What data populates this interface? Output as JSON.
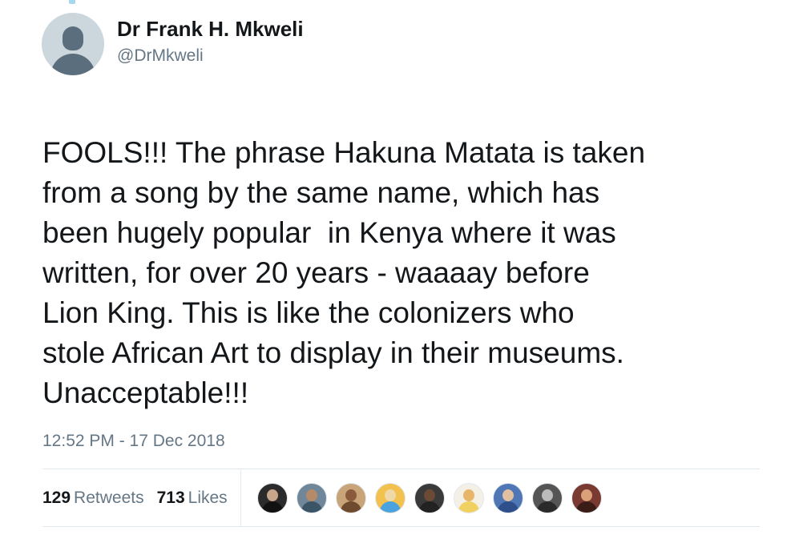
{
  "author": {
    "display_name": "Dr Frank H. Mkweli",
    "handle": "@DrMkweli",
    "avatar_icon": "default-profile-icon"
  },
  "tweet": {
    "text": "FOOLS!!! The phrase Hakuna Matata is taken\nfrom a song by the same name, which has\nbeen hugely popular  in Kenya where it was\nwritten, for over 20 years - waaaay before\nLion King. This is like the colonizers who\nstole African Art to display in their museums.\nUnacceptable!!!",
    "timestamp": "12:52 PM - 17 Dec 2018"
  },
  "stats": {
    "retweets_count": "129",
    "retweets_label": "Retweets",
    "likes_count": "713",
    "likes_label": "Likes"
  },
  "likers": [
    {
      "bg": "#2b2b2b",
      "face": "#c9a58a",
      "cloth": "#111111"
    },
    {
      "bg": "#6f8798",
      "face": "#b58a6a",
      "cloth": "#3c5566"
    },
    {
      "bg": "#c8a478",
      "face": "#8a5a3c",
      "cloth": "#6e4a2e"
    },
    {
      "bg": "#f2c14e",
      "face": "#f0d9a8",
      "cloth": "#4aa3df"
    },
    {
      "bg": "#3a3a3a",
      "face": "#6b4a36",
      "cloth": "#222222"
    },
    {
      "bg": "#f4f0e6",
      "face": "#e8b66a",
      "cloth": "#f0d060"
    },
    {
      "bg": "#4f77b5",
      "face": "#e0c0a0",
      "cloth": "#2e4f8a"
    },
    {
      "bg": "#555555",
      "face": "#bbbbbb",
      "cloth": "#2a2a2a"
    },
    {
      "bg": "#7a3a32",
      "face": "#d9a07a",
      "cloth": "#3b1d18"
    }
  ]
}
